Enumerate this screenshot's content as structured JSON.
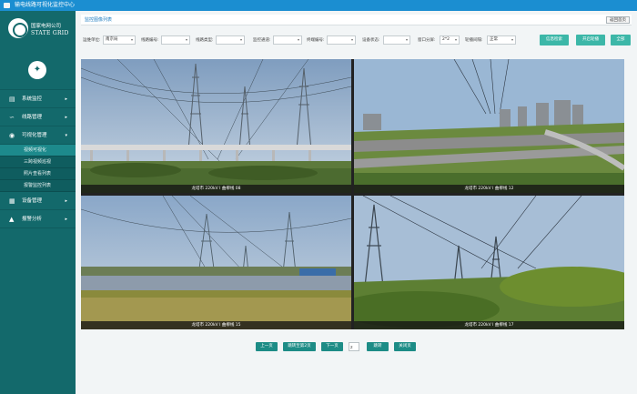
{
  "window": {
    "title": "输电线路可视化监控中心"
  },
  "brand": {
    "name_cn": "国家电网公司",
    "name_en": "STATE GRID"
  },
  "sidebar": {
    "items": [
      {
        "label": "系统监控",
        "icon": "monitor-icon"
      },
      {
        "label": "线路管理",
        "icon": "line-icon"
      },
      {
        "label": "可视化管理",
        "icon": "visual-icon"
      }
    ],
    "subitems": [
      "视频可视化",
      "三跨视频巡视",
      "照片查看列表",
      "报警监控列表"
    ],
    "items_after": [
      {
        "label": "设备管理",
        "icon": "device-icon"
      },
      {
        "label": "报警分析",
        "icon": "alarm-icon"
      }
    ]
  },
  "tabbar": {
    "tab_label": "监控图像列表",
    "return_label": "返回首页"
  },
  "filters": {
    "unit_label": "运维单位:",
    "unit_value": "南京局",
    "line_label": "线路编号:",
    "line_value": "",
    "type_label": "线路类型:",
    "type_value": "",
    "channel_label": "监控通道:",
    "channel_value": "",
    "device_label": "终端编号:",
    "device_value": "",
    "status_label": "设备状态:",
    "status_value": "",
    "grid_label": "窗口分屏:",
    "grid_value": "2*2",
    "interval_label": "轮播间隔:",
    "interval_value": "正常",
    "btn_reset": "信息检索",
    "btn_refresh": "开启轮播",
    "btn_all": "全部"
  },
  "cameras": [
    {
      "caption": "龙塔市 220kV Ⅰ 曲柳线 08",
      "stamp": ""
    },
    {
      "caption": "龙塔市 220kV Ⅰ 曲柳线 12",
      "stamp": ""
    },
    {
      "caption": "龙塔市 220kV Ⅰ 曲柳线 15",
      "stamp": ""
    },
    {
      "caption": "龙塔市 220kV Ⅰ 曲柳线 17",
      "stamp": ""
    }
  ],
  "pager": {
    "prev": "上一页",
    "mid": "跳转至第2页",
    "next": "下一页",
    "page_value": "2",
    "go": "跳转",
    "close": "关闭页"
  }
}
